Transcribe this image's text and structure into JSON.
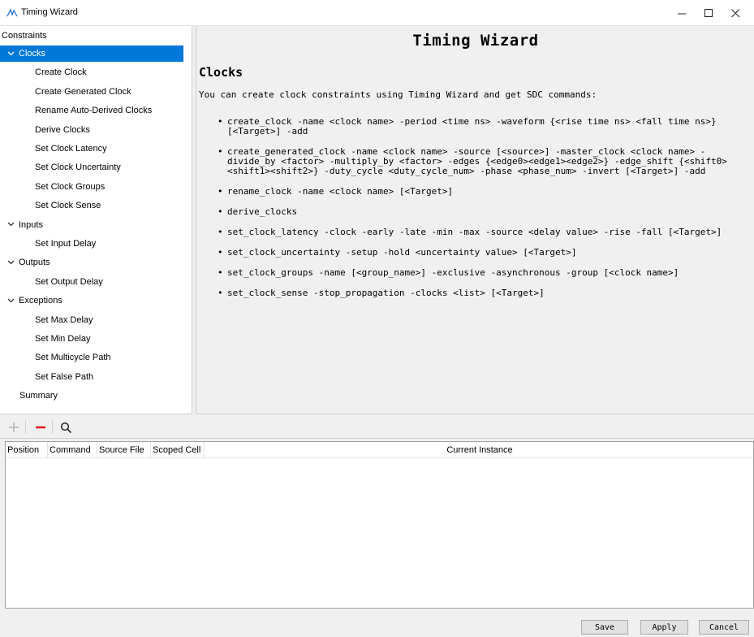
{
  "window": {
    "title": "Timing Wizard",
    "minimize_glyph": "—",
    "maximize_glyph": "☐",
    "close_glyph": "✕",
    "accent_color": "#0078d7"
  },
  "tree": {
    "root_label": "Constraints",
    "items": [
      {
        "label": "Clocks",
        "level": 1,
        "expandable": true,
        "selected": true
      },
      {
        "label": "Create Clock",
        "level": 2
      },
      {
        "label": "Create Generated Clock",
        "level": 2
      },
      {
        "label": "Rename Auto-Derived Clocks",
        "level": 2
      },
      {
        "label": "Derive Clocks",
        "level": 2
      },
      {
        "label": "Set Clock Latency",
        "level": 2
      },
      {
        "label": "Set Clock Uncertainty",
        "level": 2
      },
      {
        "label": "Set Clock Groups",
        "level": 2
      },
      {
        "label": "Set Clock Sense",
        "level": 2
      },
      {
        "label": "Inputs",
        "level": 1,
        "expandable": true
      },
      {
        "label": "Set Input Delay",
        "level": 2
      },
      {
        "label": "Outputs",
        "level": 1,
        "expandable": true
      },
      {
        "label": "Set Output Delay",
        "level": 2
      },
      {
        "label": "Exceptions",
        "level": 1,
        "expandable": true
      },
      {
        "label": "Set Max Delay",
        "level": 2
      },
      {
        "label": "Set Min Delay",
        "level": 2
      },
      {
        "label": "Set Multicycle Path",
        "level": 2
      },
      {
        "label": "Set False Path",
        "level": 2
      },
      {
        "label": "Summary",
        "level": 1
      }
    ]
  },
  "content": {
    "heading": "Timing Wizard",
    "subheading": "Clocks",
    "intro": "You can create clock constraints using Timing Wizard and get SDC commands:",
    "commands": [
      "create_clock -name <clock name> -period <time ns> -waveform {<rise time ns> <fall time ns>} [<Target>] -add",
      "create_generated_clock -name <clock name> -source [<source>] -master_clock <clock name> -divide_by <factor> -multiply_by <factor> -edges {<edge0><edge1><edge2>} -edge_shift {<shift0><shift1><shift2>} -duty_cycle <duty_cycle_num> -phase <phase_num> -invert [<Target>] -add",
      "rename_clock -name <clock name> [<Target>]",
      "derive_clocks",
      "set_clock_latency -clock -early -late -min -max -source <delay value> -rise -fall [<Target>]",
      "set_clock_uncertainty -setup -hold <uncertainty value> [<Target>]",
      "set_clock_groups -name [<group_name>] -exclusive -asynchronous -group [<clock name>]",
      "set_clock_sense -stop_propagation -clocks <list> [<Target>]"
    ]
  },
  "toolbar": {
    "add_icon": "plus-icon",
    "remove_icon": "minus-icon",
    "search_icon": "search-icon",
    "remove_color": "#e81123"
  },
  "table": {
    "columns": [
      "Position",
      "Command",
      "Source File",
      "Scoped Cell",
      "Current Instance"
    ],
    "rows": []
  },
  "footer": {
    "save_label": "Save",
    "apply_label": "Apply",
    "cancel_label": "Cancel"
  }
}
